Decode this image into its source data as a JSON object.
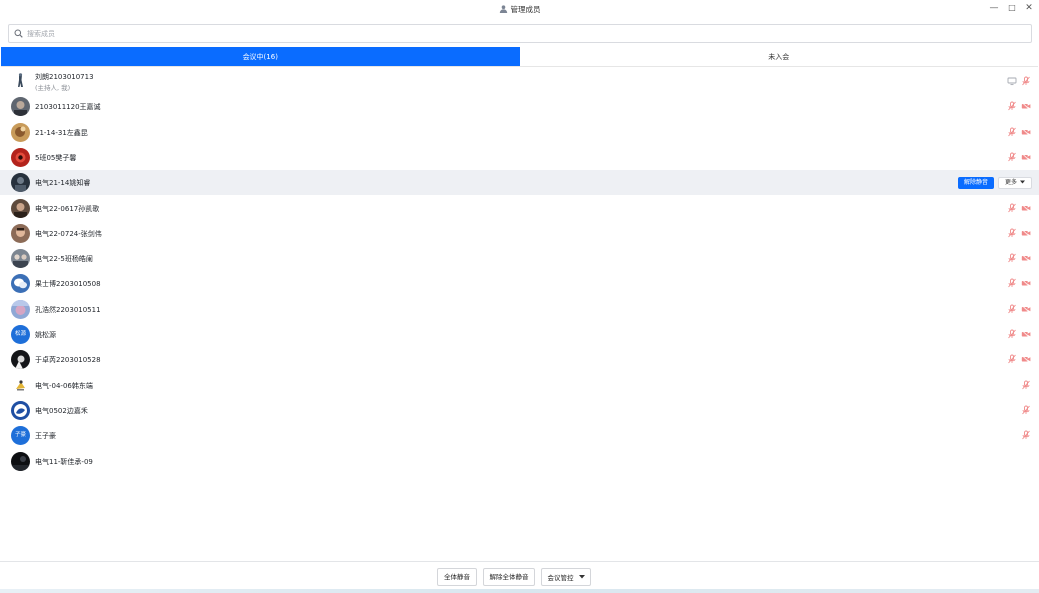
{
  "window": {
    "title": "管理成员",
    "controls": {
      "minimize": "—",
      "restore": "□",
      "close": "✕"
    }
  },
  "search": {
    "placeholder": "搜索成员",
    "value": ""
  },
  "tabs": [
    {
      "label": "会议中(16)",
      "active": true
    },
    {
      "label": "未入会",
      "active": false
    }
  ],
  "members": [
    {
      "name": "刘朗2103010713",
      "sub": "(主持人, 我)",
      "avatar": "figure",
      "icons": [
        "screen-share-icon",
        "mic-muted-icon"
      ]
    },
    {
      "name": "2103011120王嘉诚",
      "avatar": "photo-gray",
      "icons": [
        "mic-muted-icon",
        "camera-off-icon"
      ]
    },
    {
      "name": "21-14-31左鑫昆",
      "avatar": "photo-tan",
      "icons": [
        "mic-muted-icon",
        "camera-off-icon"
      ]
    },
    {
      "name": "5班05樊子馨",
      "avatar": "photo-red",
      "icons": [
        "mic-muted-icon",
        "camera-off-icon"
      ]
    },
    {
      "name": "电气21-14姚知睿",
      "avatar": "photo-dark",
      "hover": true,
      "actions": {
        "primary": "解除静音",
        "more": "更多"
      }
    },
    {
      "name": "电气22-0617孙凯歌",
      "avatar": "photo-brown",
      "icons": [
        "mic-muted-icon",
        "camera-off-icon"
      ]
    },
    {
      "name": "电气22-0724-张剑伟",
      "avatar": "photo-skin",
      "icons": [
        "mic-muted-icon",
        "camera-off-icon"
      ]
    },
    {
      "name": "电气22-5班杨皓阑",
      "avatar": "photo-group",
      "icons": [
        "mic-muted-icon",
        "camera-off-icon"
      ]
    },
    {
      "name": "果士博2203010508",
      "avatar": "photo-wechat",
      "icons": [
        "mic-muted-icon",
        "camera-off-icon"
      ]
    },
    {
      "name": "孔浩然2203010511",
      "avatar": "photo-sky",
      "icons": [
        "mic-muted-icon",
        "camera-off-icon"
      ]
    },
    {
      "name": "姚松源",
      "avatar": "text",
      "avatar_text": "松源",
      "icons": [
        "mic-muted-icon",
        "camera-off-icon"
      ]
    },
    {
      "name": "于卓芮2203010528",
      "avatar": "photo-black",
      "icons": [
        "mic-muted-icon",
        "camera-off-icon"
      ]
    },
    {
      "name": "电气-04-06韩东端",
      "avatar": "figure-yellow",
      "icons": [
        "mic-muted-icon"
      ]
    },
    {
      "name": "电气0502边嘉禾",
      "avatar": "photo-blue",
      "icons": [
        "mic-muted-icon"
      ]
    },
    {
      "name": "王子豪",
      "avatar": "text",
      "avatar_text": "子豪",
      "icons": [
        "mic-muted-icon"
      ]
    },
    {
      "name": "电气11-靳佳承-09",
      "avatar": "photo-night",
      "icons": []
    }
  ],
  "footer": {
    "mute_all": "全体静音",
    "unmute_all": "解除全体静音",
    "meeting_control": "会议管控"
  },
  "colors": {
    "accent": "#0a6cff",
    "muted_icon": "#f08a8a",
    "hover_row": "#eef0f4",
    "text_avatar": "#1e6fd9"
  }
}
